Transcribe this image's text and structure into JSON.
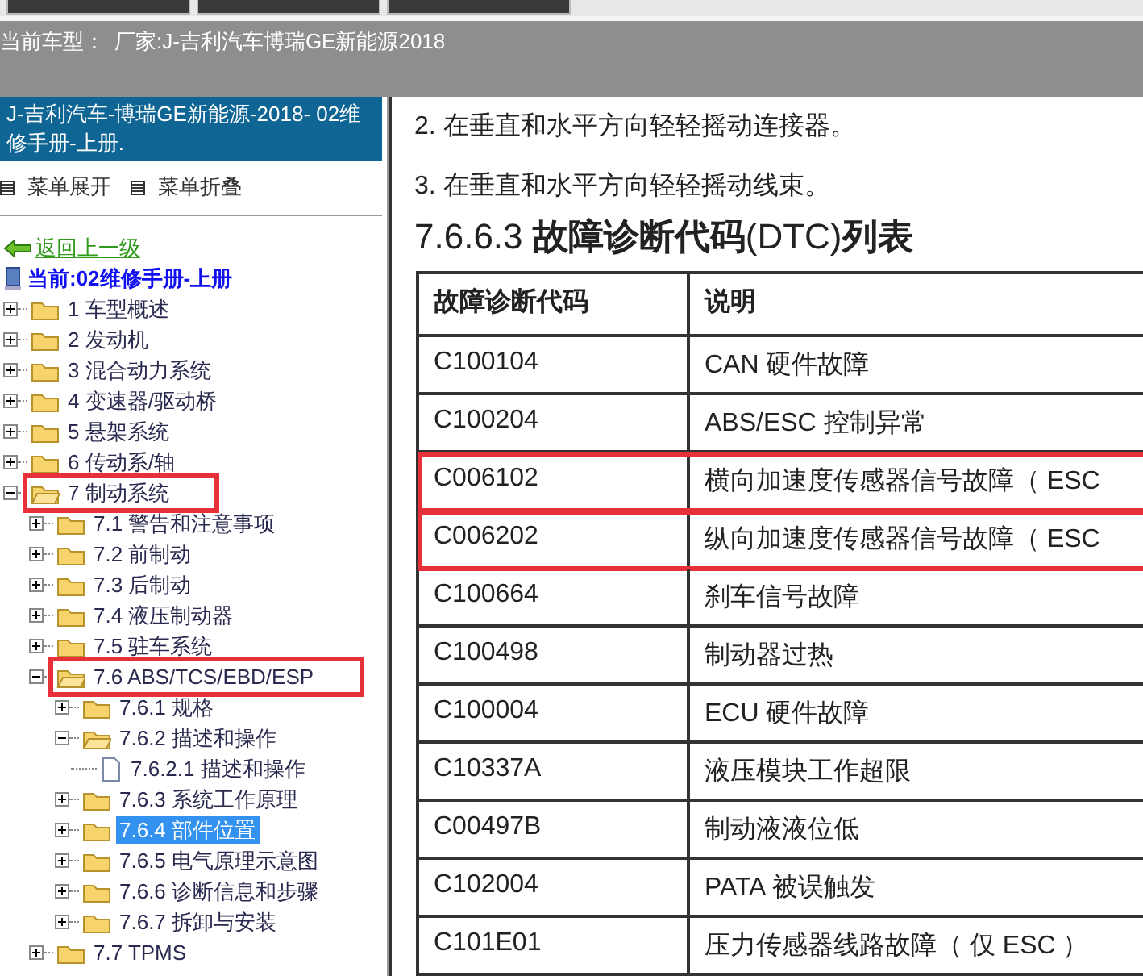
{
  "vehicle_bar": {
    "label": "当前车型：",
    "value": "厂家:J-吉利汽车博瑞GE新能源2018"
  },
  "sidebar": {
    "title": "J-吉利汽车-博瑞GE新能源-2018- 02维修手册-上册.",
    "menu": [
      "菜单展开",
      "菜单折叠"
    ],
    "back_link": "返回上一级",
    "current": "当前:02维修手册-上册",
    "tree": [
      {
        "label": "1 车型概述",
        "kind": "folder",
        "expanded": false,
        "selected": false,
        "highlighted": false
      },
      {
        "label": "2 发动机",
        "kind": "folder",
        "expanded": false,
        "selected": false,
        "highlighted": false
      },
      {
        "label": "3 混合动力系统",
        "kind": "folder",
        "expanded": false,
        "selected": false,
        "highlighted": false
      },
      {
        "label": "4 变速器/驱动桥",
        "kind": "folder",
        "expanded": false,
        "selected": false,
        "highlighted": false
      },
      {
        "label": "5 悬架系统",
        "kind": "folder",
        "expanded": false,
        "selected": false,
        "highlighted": false
      },
      {
        "label": "6 传动系/轴",
        "kind": "folder",
        "expanded": false,
        "selected": false,
        "highlighted": false
      },
      {
        "label": "7 制动系统",
        "kind": "folder",
        "expanded": true,
        "selected": false,
        "highlighted": true,
        "children": [
          {
            "label": "7.1 警告和注意事项",
            "kind": "folder",
            "expanded": false,
            "selected": false,
            "highlighted": false
          },
          {
            "label": "7.2 前制动",
            "kind": "folder",
            "expanded": false,
            "selected": false,
            "highlighted": false
          },
          {
            "label": "7.3 后制动",
            "kind": "folder",
            "expanded": false,
            "selected": false,
            "highlighted": false
          },
          {
            "label": "7.4 液压制动器",
            "kind": "folder",
            "expanded": false,
            "selected": false,
            "highlighted": false
          },
          {
            "label": "7.5 驻车系统",
            "kind": "folder",
            "expanded": false,
            "selected": false,
            "highlighted": false
          },
          {
            "label": "7.6 ABS/TCS/EBD/ESP",
            "kind": "folder",
            "expanded": true,
            "selected": false,
            "highlighted": true,
            "children": [
              {
                "label": "7.6.1 规格",
                "kind": "folder",
                "expanded": false,
                "selected": false,
                "highlighted": false
              },
              {
                "label": "7.6.2 描述和操作",
                "kind": "folder",
                "expanded": true,
                "selected": false,
                "highlighted": false,
                "children": [
                  {
                    "label": "7.6.2.1 描述和操作",
                    "kind": "page",
                    "selected": false,
                    "highlighted": false
                  }
                ]
              },
              {
                "label": "7.6.3 系统工作原理",
                "kind": "folder",
                "expanded": false,
                "selected": false,
                "highlighted": false
              },
              {
                "label": "7.6.4 部件位置",
                "kind": "folder",
                "expanded": false,
                "selected": true,
                "highlighted": false
              },
              {
                "label": "7.6.5 电气原理示意图",
                "kind": "folder",
                "expanded": false,
                "selected": false,
                "highlighted": false
              },
              {
                "label": "7.6.6 诊断信息和步骤",
                "kind": "folder",
                "expanded": false,
                "selected": false,
                "highlighted": false
              },
              {
                "label": "7.6.7 拆卸与安装",
                "kind": "folder",
                "expanded": false,
                "selected": false,
                "highlighted": false
              }
            ]
          },
          {
            "label": "7.7 TPMS",
            "kind": "folder",
            "expanded": false,
            "selected": false,
            "highlighted": false
          }
        ]
      }
    ]
  },
  "document": {
    "steps": [
      "2. 在垂直和水平方向轻轻摇动连接器。",
      "3. 在垂直和水平方向轻轻摇动线束。"
    ],
    "heading": "7.6.6.3 **故障诊断代码**(DTC)**列表**",
    "table": {
      "columns": [
        "故障诊断代码",
        "说明"
      ],
      "rows": [
        {
          "code": "C100104",
          "description": "CAN 硬件故障",
          "highlighted": false
        },
        {
          "code": "C100204",
          "description": "ABS/ESC 控制异常",
          "highlighted": false
        },
        {
          "code": "C006102",
          "description": "横向加速度传感器信号故障（ ESC",
          "highlighted": true
        },
        {
          "code": "C006202",
          "description": "纵向加速度传感器信号故障（ ESC",
          "highlighted": true
        },
        {
          "code": "C100664",
          "description": "刹车信号故障",
          "highlighted": false
        },
        {
          "code": "C100498",
          "description": "制动器过热",
          "highlighted": false
        },
        {
          "code": "C100004",
          "description": "ECU 硬件故障",
          "highlighted": false
        },
        {
          "code": "C10337A",
          "description": "液压模块工作超限",
          "highlighted": false
        },
        {
          "code": "C00497B",
          "description": "制动液液位低",
          "highlighted": false
        },
        {
          "code": "C102004",
          "description": "PATA 被误触发",
          "highlighted": false
        },
        {
          "code": "C101E01",
          "description": "压力传感器线路故障（ 仅 ESC ）",
          "highlighted": false
        }
      ]
    }
  }
}
